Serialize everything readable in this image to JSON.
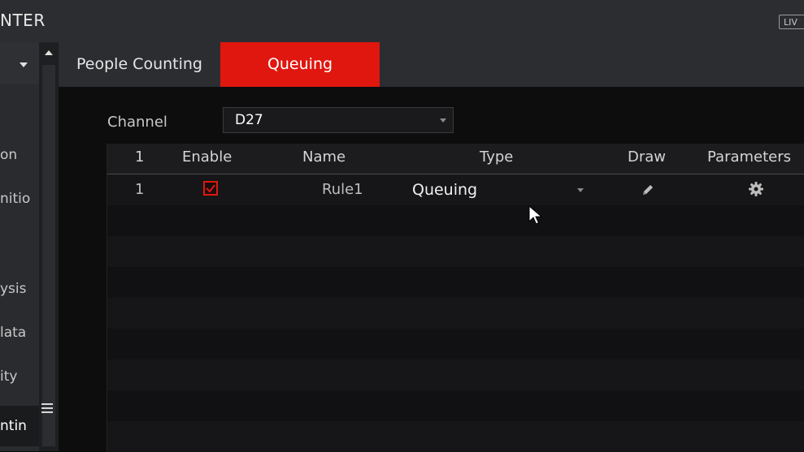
{
  "header": {
    "title": "NTER",
    "live_badge": "LIV"
  },
  "sidebar": {
    "items": [
      {
        "label": "on",
        "active": false
      },
      {
        "label": "nitio",
        "active": false
      },
      {
        "label": "ysis",
        "active": false
      },
      {
        "label": "lata",
        "active": false
      },
      {
        "label": "ity",
        "active": false
      },
      {
        "label": "ntin",
        "active": true
      }
    ]
  },
  "tabs": [
    {
      "label": "People Counting",
      "active": false
    },
    {
      "label": "Queuing",
      "active": true
    }
  ],
  "channel": {
    "label": "Channel",
    "value": "D27"
  },
  "table": {
    "headers": {
      "index": "1",
      "enable": "Enable",
      "name": "Name",
      "type": "Type",
      "draw": "Draw",
      "parameters": "Parameters"
    },
    "rows": [
      {
        "index": "1",
        "enabled": true,
        "name": "Rule1",
        "type": "Queuing"
      }
    ]
  },
  "colors": {
    "accent": "#e0170f",
    "background": "#0b0b0b",
    "header": "#2c2d30"
  },
  "icons": {
    "draw": "pencil-icon",
    "parameters": "gear-icon",
    "enable": "checkbox-checked-icon"
  }
}
